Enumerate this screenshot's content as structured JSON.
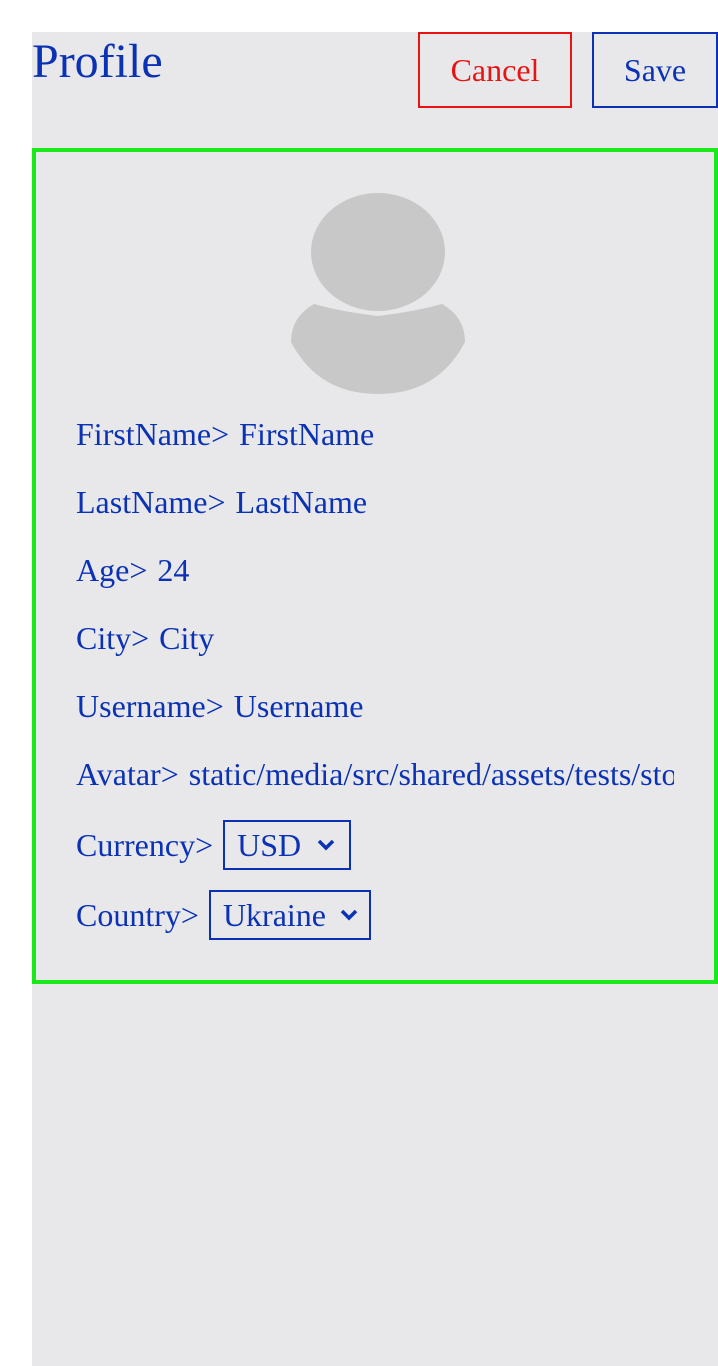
{
  "header": {
    "title": "Profile",
    "cancel_label": "Cancel",
    "save_label": "Save"
  },
  "profile": {
    "avatar_icon": "user-silhouette-icon",
    "fields": {
      "first_name": {
        "label": "FirstName>",
        "value": "FirstName"
      },
      "last_name": {
        "label": "LastName>",
        "value": "LastName"
      },
      "age": {
        "label": "Age>",
        "value": "24"
      },
      "city": {
        "label": "City>",
        "value": "City"
      },
      "username": {
        "label": "Username>",
        "value": "Username"
      },
      "avatar": {
        "label": "Avatar>",
        "value": "static/media/src/shared/assets/tests/sto"
      },
      "currency": {
        "label": "Currency>",
        "selected": "USD"
      },
      "country": {
        "label": "Country>",
        "selected": "Ukraine"
      }
    }
  },
  "colors": {
    "primary": "#0b32b4",
    "danger": "#e81414",
    "card_border": "#1be81b",
    "background": "#e8e8eb",
    "avatar": "#c8c8c8"
  }
}
